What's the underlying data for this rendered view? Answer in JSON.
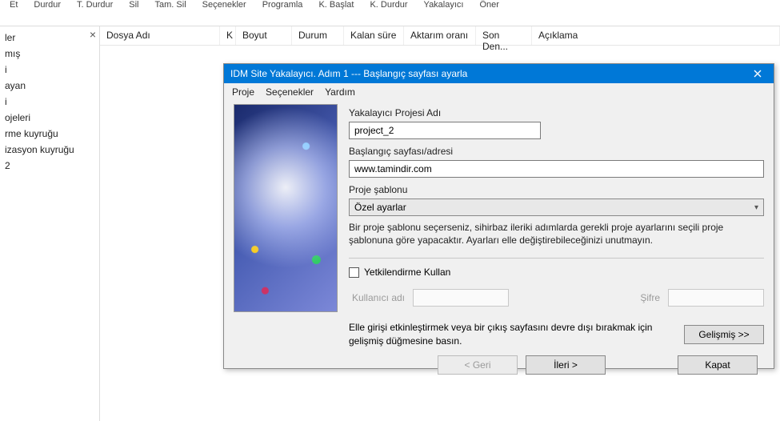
{
  "toolbar": {
    "items": [
      "Et",
      "Durdur",
      "T. Durdur",
      "Sil",
      "Tam. Sil",
      "Seçenekler",
      "Programla",
      "K. Başlat",
      "K. Durdur",
      "Yakalayıcı",
      "Öner"
    ]
  },
  "sidebar": {
    "items": [
      "ler",
      "mış",
      "i",
      "ayan",
      "i",
      "ojeleri",
      "rme kuyruğu",
      "izasyon kuyruğu",
      "2"
    ]
  },
  "columns": [
    "Dosya Adı",
    "K",
    "Boyut",
    "Durum",
    "Kalan süre",
    "Aktarım oranı",
    "Son Den...",
    "Açıklama"
  ],
  "dialog": {
    "title": "IDM Site Yakalayıcı. Adım 1 --- Başlangıç sayfası ayarla",
    "menu": [
      "Proje",
      "Seçenekler",
      "Yardım"
    ],
    "project_name_label": "Yakalayıcı Projesi Adı",
    "project_name_value": "project_2",
    "start_page_label": "Başlangıç sayfası/adresi",
    "start_page_value": "www.tamindir.com",
    "template_label": "Proje şablonu",
    "template_value": "Özel ayarlar",
    "template_hint": "Bir proje şablonu seçerseniz, sihirbaz ileriki adımlarda gerekli proje ayarlarını seçili proje şablonuna göre yapacaktır. Ayarları elle değiştirebileceğinizi unutmayın.",
    "auth_label": "Yetkilendirme Kullan",
    "user_label": "Kullanıcı adı",
    "pass_label": "Şifre",
    "advanced_note": "Elle girişi etkinleştirmek veya bir çıkış sayfasını devre dışı bırakmak için gelişmiş düğmesine basın.",
    "advanced_btn": "Gelişmiş >>",
    "back": "< Geri",
    "next": "İleri >",
    "close": "Kapat"
  }
}
